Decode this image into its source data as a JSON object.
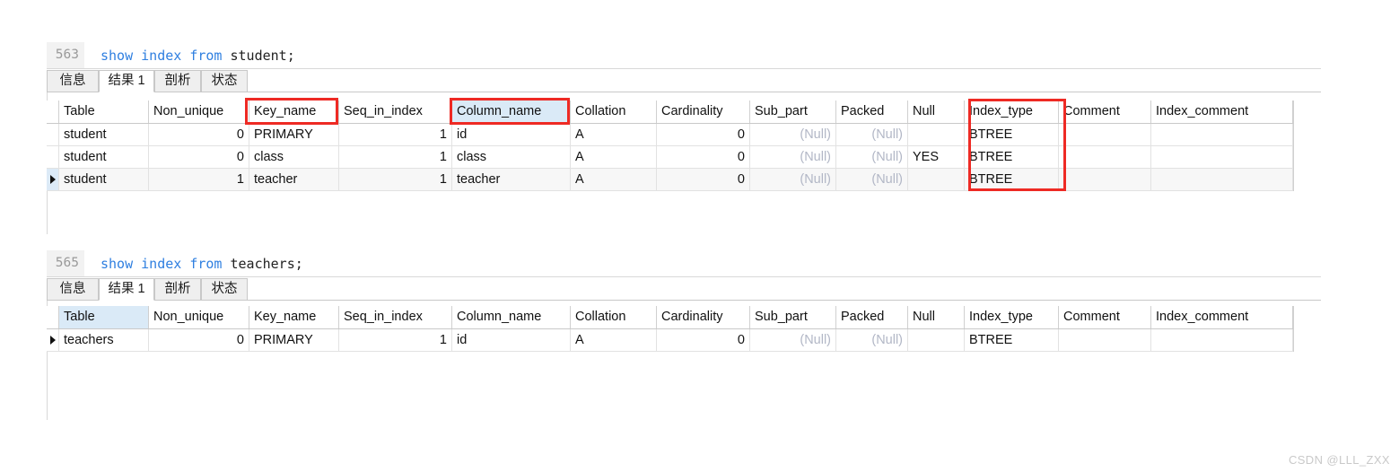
{
  "app": {
    "watermark": "CSDN @LLL_ZXX"
  },
  "queries": [
    {
      "line_number": "563",
      "sql_keywords": "show index from ",
      "sql_rest": "student;",
      "tabs": [
        {
          "label": "信息",
          "active": false
        },
        {
          "label": "结果 1",
          "active": true
        },
        {
          "label": "剖析",
          "active": false
        },
        {
          "label": "状态",
          "active": false
        }
      ],
      "columns": [
        "Table",
        "Non_unique",
        "Key_name",
        "Seq_in_index",
        "Column_name",
        "Collation",
        "Cardinality",
        "Sub_part",
        "Packed",
        "Null",
        "Index_type",
        "Comment",
        "Index_comment"
      ],
      "rows": [
        {
          "selected": false,
          "cells": [
            "student",
            "0",
            "PRIMARY",
            "1",
            "id",
            "A",
            "0",
            "(Null)",
            "(Null)",
            "",
            "BTREE",
            "",
            ""
          ]
        },
        {
          "selected": false,
          "cells": [
            "student",
            "0",
            "class",
            "1",
            "class",
            "A",
            "0",
            "(Null)",
            "(Null)",
            "YES",
            "BTREE",
            "",
            ""
          ]
        },
        {
          "selected": true,
          "cells": [
            "student",
            "1",
            "teacher",
            "1",
            "teacher",
            "A",
            "0",
            "(Null)",
            "(Null)",
            "",
            "BTREE",
            "",
            ""
          ]
        }
      ]
    },
    {
      "line_number": "565",
      "sql_keywords": "show index from ",
      "sql_rest": "teachers;",
      "tabs": [
        {
          "label": "信息",
          "active": false
        },
        {
          "label": "结果 1",
          "active": true
        },
        {
          "label": "剖析",
          "active": false
        },
        {
          "label": "状态",
          "active": false
        }
      ],
      "columns": [
        "Table",
        "Non_unique",
        "Key_name",
        "Seq_in_index",
        "Column_name",
        "Collation",
        "Cardinality",
        "Sub_part",
        "Packed",
        "Null",
        "Index_type",
        "Comment",
        "Index_comment"
      ],
      "rows": [
        {
          "selected": true,
          "cells": [
            "teachers",
            "0",
            "PRIMARY",
            "1",
            "id",
            "A",
            "0",
            "(Null)",
            "(Null)",
            "",
            "BTREE",
            "",
            ""
          ]
        }
      ]
    }
  ],
  "annotations": {
    "highlight_color": "#daeaf7",
    "box_color": "#ee2a24",
    "highlighted_headers_q1": [
      "Key_name",
      "Column_name",
      "Index_type"
    ],
    "highlighted_headers_q2": [
      "Table"
    ]
  }
}
